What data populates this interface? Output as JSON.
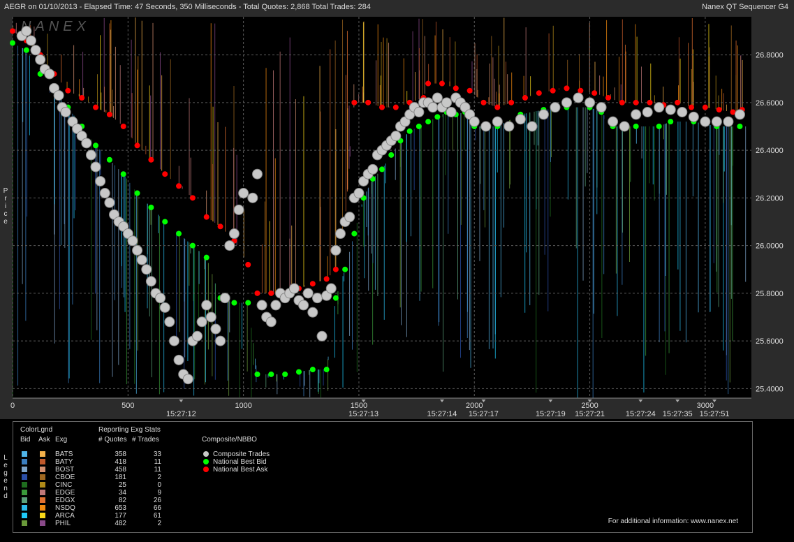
{
  "header": {
    "title_left": "AEGR on 01/10/2013  -  Elapsed Time: 47 Seconds, 350 Milliseconds  -  Total Quotes: 2,868  Total Trades: 284",
    "title_right": "Nanex QT Sequencer G4",
    "watermark": "NANEX"
  },
  "colors": {
    "background": "#000000",
    "grid": "#5a5a5a",
    "trade": "#c8c8c8",
    "best_bid": "#00ff00",
    "best_ask": "#ff0000"
  },
  "chart_data": {
    "type": "scatter",
    "title": "",
    "ylabel": "Price",
    "xlim": [
      0,
      3200
    ],
    "ylim": [
      25.36,
      26.96
    ],
    "x_ticks": [
      0,
      500,
      1000,
      1500,
      2000,
      2500,
      3000
    ],
    "y_ticks": [
      25.4,
      25.6,
      25.8,
      26.0,
      26.2,
      26.4,
      26.6,
      26.8
    ],
    "y_tick_labels": [
      "25.4000",
      "25.6000",
      "25.8000",
      "26.0000",
      "26.2000",
      "26.4000",
      "26.6000",
      "26.8000"
    ],
    "time_labels": [
      {
        "x": 730,
        "label": "15:27:12"
      },
      {
        "x": 1520,
        "label": "15:27:13"
      },
      {
        "x": 1860,
        "label": "15:27:14"
      },
      {
        "x": 2040,
        "label": "15:27:17"
      },
      {
        "x": 2330,
        "label": "15:27:19"
      },
      {
        "x": 2500,
        "label": "15:27:21"
      },
      {
        "x": 2720,
        "label": "15:27:24"
      },
      {
        "x": 2880,
        "label": "15:27:35"
      },
      {
        "x": 3040,
        "label": "15:27:51"
      }
    ],
    "series": [
      {
        "name": "Composite Trades",
        "color": "#c8c8c8",
        "points": [
          [
            40,
            26.88
          ],
          [
            60,
            26.9
          ],
          [
            80,
            26.86
          ],
          [
            100,
            26.82
          ],
          [
            120,
            26.78
          ],
          [
            140,
            26.74
          ],
          [
            160,
            26.72
          ],
          [
            180,
            26.66
          ],
          [
            200,
            26.63
          ],
          [
            215,
            26.58
          ],
          [
            230,
            26.56
          ],
          [
            260,
            26.52
          ],
          [
            280,
            26.49
          ],
          [
            300,
            26.46
          ],
          [
            320,
            26.43
          ],
          [
            340,
            26.38
          ],
          [
            360,
            26.33
          ],
          [
            380,
            26.27
          ],
          [
            400,
            26.22
          ],
          [
            420,
            26.18
          ],
          [
            440,
            26.13
          ],
          [
            460,
            26.1
          ],
          [
            480,
            26.08
          ],
          [
            500,
            26.05
          ],
          [
            520,
            26.02
          ],
          [
            540,
            25.98
          ],
          [
            560,
            25.94
          ],
          [
            580,
            25.9
          ],
          [
            600,
            25.85
          ],
          [
            620,
            25.8
          ],
          [
            640,
            25.78
          ],
          [
            660,
            25.74
          ],
          [
            680,
            25.68
          ],
          [
            700,
            25.6
          ],
          [
            720,
            25.52
          ],
          [
            740,
            25.46
          ],
          [
            760,
            25.44
          ],
          [
            780,
            25.6
          ],
          [
            800,
            25.62
          ],
          [
            820,
            25.68
          ],
          [
            840,
            25.75
          ],
          [
            860,
            25.7
          ],
          [
            880,
            25.65
          ],
          [
            900,
            25.6
          ],
          [
            920,
            25.78
          ],
          [
            940,
            26.0
          ],
          [
            960,
            26.05
          ],
          [
            980,
            26.15
          ],
          [
            1000,
            26.22
          ],
          [
            1040,
            26.2
          ],
          [
            1060,
            26.3
          ],
          [
            1080,
            25.75
          ],
          [
            1100,
            25.7
          ],
          [
            1120,
            25.68
          ],
          [
            1140,
            25.75
          ],
          [
            1160,
            25.8
          ],
          [
            1180,
            25.78
          ],
          [
            1200,
            25.8
          ],
          [
            1220,
            25.82
          ],
          [
            1240,
            25.77
          ],
          [
            1260,
            25.75
          ],
          [
            1280,
            25.8
          ],
          [
            1300,
            25.72
          ],
          [
            1320,
            25.78
          ],
          [
            1340,
            25.62
          ],
          [
            1360,
            25.79
          ],
          [
            1380,
            25.82
          ],
          [
            1400,
            25.98
          ],
          [
            1420,
            26.05
          ],
          [
            1440,
            26.1
          ],
          [
            1460,
            26.12
          ],
          [
            1480,
            26.2
          ],
          [
            1500,
            26.22
          ],
          [
            1520,
            26.27
          ],
          [
            1540,
            26.3
          ],
          [
            1560,
            26.32
          ],
          [
            1580,
            26.38
          ],
          [
            1600,
            26.4
          ],
          [
            1620,
            26.42
          ],
          [
            1640,
            26.44
          ],
          [
            1660,
            26.46
          ],
          [
            1680,
            26.5
          ],
          [
            1700,
            26.52
          ],
          [
            1720,
            26.55
          ],
          [
            1740,
            26.58
          ],
          [
            1760,
            26.56
          ],
          [
            1780,
            26.6
          ],
          [
            1800,
            26.6
          ],
          [
            1820,
            26.58
          ],
          [
            1840,
            26.62
          ],
          [
            1860,
            26.58
          ],
          [
            1880,
            26.6
          ],
          [
            1900,
            26.56
          ],
          [
            1920,
            26.62
          ],
          [
            1940,
            26.6
          ],
          [
            1960,
            26.58
          ],
          [
            1980,
            26.55
          ],
          [
            2000,
            26.52
          ],
          [
            2050,
            26.5
          ],
          [
            2100,
            26.52
          ],
          [
            2150,
            26.5
          ],
          [
            2200,
            26.53
          ],
          [
            2250,
            26.5
          ],
          [
            2300,
            26.55
          ],
          [
            2350,
            26.58
          ],
          [
            2400,
            26.6
          ],
          [
            2450,
            26.62
          ],
          [
            2500,
            26.6
          ],
          [
            2550,
            26.58
          ],
          [
            2600,
            26.52
          ],
          [
            2650,
            26.5
          ],
          [
            2700,
            26.55
          ],
          [
            2750,
            26.56
          ],
          [
            2800,
            26.58
          ],
          [
            2850,
            26.57
          ],
          [
            2900,
            26.56
          ],
          [
            2950,
            26.54
          ],
          [
            3000,
            26.52
          ],
          [
            3050,
            26.52
          ],
          [
            3100,
            26.52
          ],
          [
            3150,
            26.55
          ]
        ]
      },
      {
        "name": "National Best Bid",
        "color": "#00ff00",
        "points": [
          [
            0,
            26.85
          ],
          [
            60,
            26.82
          ],
          [
            120,
            26.72
          ],
          [
            180,
            26.65
          ],
          [
            240,
            26.58
          ],
          [
            300,
            26.5
          ],
          [
            360,
            26.42
          ],
          [
            420,
            26.36
          ],
          [
            480,
            26.3
          ],
          [
            540,
            26.22
          ],
          [
            600,
            26.16
          ],
          [
            660,
            26.1
          ],
          [
            720,
            26.05
          ],
          [
            780,
            26.0
          ],
          [
            840,
            25.95
          ],
          [
            900,
            25.78
          ],
          [
            960,
            25.76
          ],
          [
            1020,
            25.76
          ],
          [
            1060,
            25.46
          ],
          [
            1120,
            25.46
          ],
          [
            1180,
            25.46
          ],
          [
            1240,
            25.47
          ],
          [
            1300,
            25.48
          ],
          [
            1360,
            25.48
          ],
          [
            1400,
            25.78
          ],
          [
            1440,
            25.9
          ],
          [
            1480,
            26.05
          ],
          [
            1520,
            26.2
          ],
          [
            1560,
            26.28
          ],
          [
            1600,
            26.32
          ],
          [
            1640,
            26.38
          ],
          [
            1680,
            26.44
          ],
          [
            1720,
            26.48
          ],
          [
            1760,
            26.5
          ],
          [
            1800,
            26.52
          ],
          [
            1840,
            26.54
          ],
          [
            1880,
            26.56
          ],
          [
            1920,
            26.55
          ],
          [
            1960,
            26.56
          ],
          [
            2000,
            26.5
          ],
          [
            2100,
            26.5
          ],
          [
            2200,
            26.55
          ],
          [
            2300,
            26.57
          ],
          [
            2400,
            26.58
          ],
          [
            2500,
            26.58
          ],
          [
            2550,
            26.56
          ],
          [
            2600,
            26.5
          ],
          [
            2700,
            26.5
          ],
          [
            2800,
            26.5
          ],
          [
            2850,
            26.52
          ],
          [
            2950,
            26.52
          ],
          [
            3050,
            26.5
          ],
          [
            3150,
            26.5
          ]
        ]
      },
      {
        "name": "National Best Ask",
        "color": "#ff0000",
        "points": [
          [
            0,
            26.9
          ],
          [
            60,
            26.86
          ],
          [
            120,
            26.8
          ],
          [
            180,
            26.72
          ],
          [
            240,
            26.65
          ],
          [
            300,
            26.62
          ],
          [
            360,
            26.58
          ],
          [
            420,
            26.55
          ],
          [
            480,
            26.5
          ],
          [
            540,
            26.42
          ],
          [
            600,
            26.36
          ],
          [
            660,
            26.3
          ],
          [
            720,
            26.25
          ],
          [
            780,
            26.2
          ],
          [
            840,
            26.12
          ],
          [
            900,
            26.08
          ],
          [
            960,
            26.02
          ],
          [
            1020,
            25.92
          ],
          [
            1060,
            25.8
          ],
          [
            1120,
            25.8
          ],
          [
            1180,
            25.8
          ],
          [
            1240,
            25.82
          ],
          [
            1300,
            25.84
          ],
          [
            1360,
            25.86
          ],
          [
            1400,
            25.9
          ],
          [
            1440,
            26.1
          ],
          [
            1480,
            26.6
          ],
          [
            1540,
            26.6
          ],
          [
            1600,
            26.58
          ],
          [
            1660,
            26.58
          ],
          [
            1720,
            26.6
          ],
          [
            1780,
            26.62
          ],
          [
            1800,
            26.68
          ],
          [
            1860,
            26.68
          ],
          [
            1920,
            26.66
          ],
          [
            1980,
            26.65
          ],
          [
            2040,
            26.6
          ],
          [
            2100,
            26.58
          ],
          [
            2160,
            26.6
          ],
          [
            2220,
            26.62
          ],
          [
            2280,
            26.64
          ],
          [
            2340,
            26.65
          ],
          [
            2400,
            26.66
          ],
          [
            2460,
            26.65
          ],
          [
            2520,
            26.64
          ],
          [
            2580,
            26.62
          ],
          [
            2640,
            26.6
          ],
          [
            2700,
            26.6
          ],
          [
            2760,
            26.6
          ],
          [
            2820,
            26.59
          ],
          [
            2880,
            26.6
          ],
          [
            2940,
            26.58
          ],
          [
            3000,
            26.58
          ],
          [
            3060,
            26.57
          ],
          [
            3120,
            26.56
          ],
          [
            3160,
            26.57
          ]
        ]
      }
    ]
  },
  "axis": {
    "price_label": "Price"
  },
  "legend": {
    "side_label": "Legend",
    "color_legend_title": "ColorLgnd",
    "stats_title": "Reporting Exg Stats",
    "col_bid": "Bid",
    "col_ask": "Ask",
    "col_exg": "Exg",
    "col_quotes": "# Quotes",
    "col_trades": "# Trades",
    "composite_title": "Composite/NBBO",
    "composite_items": [
      {
        "label": "Composite Trades",
        "color": "#c8c8c8"
      },
      {
        "label": "National Best Bid",
        "color": "#00ff00"
      },
      {
        "label": "National Best Ask",
        "color": "#ff0000"
      }
    ],
    "exchanges": [
      {
        "exg": "BATS",
        "quotes": "358",
        "trades": "33",
        "bid_color": "#4fb4e8",
        "ask_color": "#f2b04a"
      },
      {
        "exg": "BATY",
        "quotes": "418",
        "trades": "11",
        "bid_color": "#3a7ec0",
        "ask_color": "#c0582a"
      },
      {
        "exg": "BOST",
        "quotes": "458",
        "trades": "11",
        "bid_color": "#7ca3c8",
        "ask_color": "#d49070"
      },
      {
        "exg": "CBOE",
        "quotes": "181",
        "trades": "2",
        "bid_color": "#2a4fa8",
        "ask_color": "#a06820"
      },
      {
        "exg": "CINC",
        "quotes": "25",
        "trades": "0",
        "bid_color": "#1e6e1e",
        "ask_color": "#b08a18"
      },
      {
        "exg": "EDGE",
        "quotes": "34",
        "trades": "9",
        "bid_color": "#3a9a3a",
        "ask_color": "#c07878"
      },
      {
        "exg": "EDGX",
        "quotes": "82",
        "trades": "26",
        "bid_color": "#5aa07a",
        "ask_color": "#e07030"
      },
      {
        "exg": "NSDQ",
        "quotes": "653",
        "trades": "66",
        "bid_color": "#2ab8e8",
        "ask_color": "#f08a10"
      },
      {
        "exg": "ARCA",
        "quotes": "177",
        "trades": "61",
        "bid_color": "#1ec8f8",
        "ask_color": "#f8d818"
      },
      {
        "exg": "PHIL",
        "quotes": "482",
        "trades": "2",
        "bid_color": "#6a9a3a",
        "ask_color": "#8a4a8a"
      }
    ],
    "footer": "For additional information: www.nanex.net"
  }
}
